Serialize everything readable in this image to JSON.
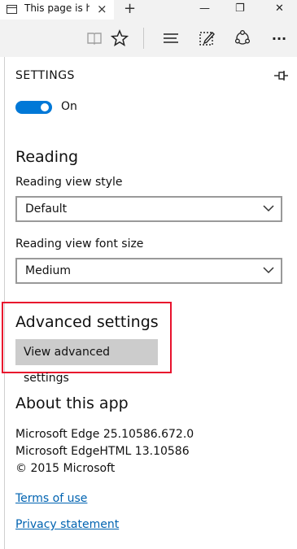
{
  "tab": {
    "title": "This page is h",
    "close": "×",
    "new_tab": "+"
  },
  "window_controls": {
    "minimize": "—",
    "restore": "❐",
    "close": "✕"
  },
  "toolbar": {
    "reading_view_icon": "reading-view-icon",
    "favorites_icon": "star-icon",
    "hub_icon": "hub-icon",
    "web_note_icon": "web-note-icon",
    "share_icon": "share-icon",
    "more_label": "···"
  },
  "settings": {
    "title": "SETTINGS",
    "toggle_label": "On",
    "reading_heading": "Reading",
    "reading_view_style_label": "Reading view style",
    "reading_view_style_value": "Default",
    "reading_view_font_label": "Reading view font size",
    "reading_view_font_value": "Medium",
    "advanced_heading": "Advanced settings",
    "advanced_button": "View advanced settings",
    "about_heading": "About this app",
    "about_lines": [
      "Microsoft Edge 25.10586.672.0",
      "Microsoft EdgeHTML 13.10586",
      "© 2015 Microsoft"
    ],
    "terms_link": "Terms of use",
    "privacy_link": "Privacy statement"
  },
  "colors": {
    "accent": "#0078d7",
    "highlight_border": "#e8112d",
    "link": "#0063b1"
  }
}
